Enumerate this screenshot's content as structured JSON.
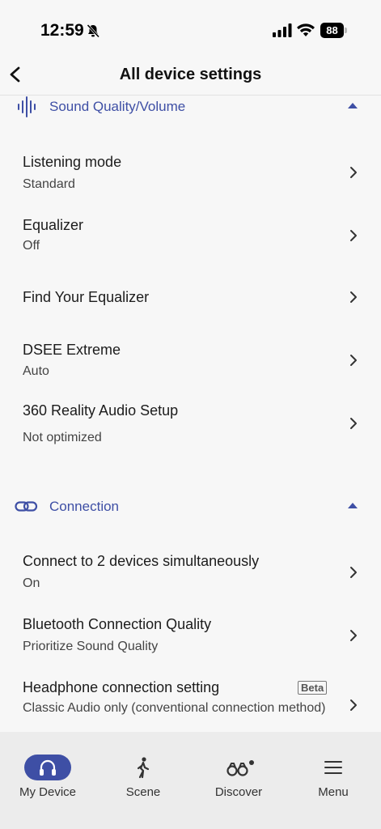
{
  "status_bar": {
    "time": "12:59",
    "battery": "88",
    "icons": [
      "bell-slash-icon",
      "signal-icon",
      "wifi-icon",
      "battery-icon"
    ]
  },
  "header": {
    "title": "All device settings",
    "back_icon": "chevron-left-icon"
  },
  "sections": {
    "sound": {
      "label": "Sound Quality/Volume",
      "icon": "sound-wave-icon",
      "items": [
        {
          "title": "Listening mode",
          "value": "Standard"
        },
        {
          "title": "Equalizer",
          "value": "Off"
        },
        {
          "title": "Find Your Equalizer",
          "value": ""
        },
        {
          "title": "DSEE Extreme",
          "value": "Auto"
        },
        {
          "title": "360 Reality Audio Setup",
          "value": "Not optimized"
        }
      ]
    },
    "connection": {
      "label": "Connection",
      "icon": "link-icon",
      "items": [
        {
          "title": "Connect to 2 devices simultaneously",
          "value": "On"
        },
        {
          "title": "Bluetooth Connection Quality",
          "value": "Prioritize Sound Quality"
        },
        {
          "title": "Headphone connection setting",
          "badge": "Beta",
          "value": "Classic Audio only (conventional connection method)"
        }
      ]
    }
  },
  "bottom_nav": {
    "items": [
      {
        "label": "My Device",
        "icon": "headphones-icon",
        "active": true
      },
      {
        "label": "Scene",
        "icon": "walking-icon",
        "active": false
      },
      {
        "label": "Discover",
        "icon": "binoculars-icon",
        "active": false
      },
      {
        "label": "Menu",
        "icon": "hamburger-icon",
        "active": false
      }
    ]
  },
  "colors": {
    "accent": "#3e4fa5",
    "background": "#f7f7f7",
    "nav_background": "#ececec"
  }
}
